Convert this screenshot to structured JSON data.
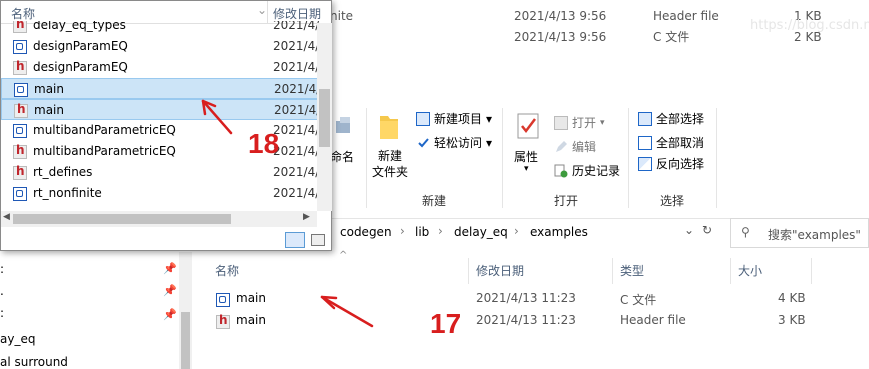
{
  "background_rows": [
    {
      "name": "nite",
      "date": "2021/4/13 9:56",
      "type": "Header file",
      "size": "1 KB"
    },
    {
      "name": "",
      "date": "2021/4/13 9:56",
      "type": "C 文件",
      "size": "2 KB"
    }
  ],
  "watermark": "https://blog.csdn.n",
  "ribbon": {
    "partial_label": "命名",
    "new_folder": "新建\n文件夹",
    "new_item": "新建项目",
    "easy_access": "轻松访问",
    "group_new": "新建",
    "properties": "属性",
    "open": "打开",
    "edit": "编辑",
    "history": "历史记录",
    "group_open": "打开",
    "select_all": "全部选择",
    "select_none": "全部取消",
    "invert": "反向选择",
    "group_select": "选择"
  },
  "address": {
    "crumbs": [
      "codegen",
      "lib",
      "delay_eq",
      "examples"
    ]
  },
  "search": {
    "placeholder": "搜索\"examples\""
  },
  "nav": {
    "items": [
      "ay_eq",
      "al surround"
    ]
  },
  "columns": {
    "name": "名称",
    "date": "修改日期",
    "type": "类型",
    "size": "大小"
  },
  "files": [
    {
      "name": "main",
      "date": "2021/4/13 11:23",
      "type": "C 文件",
      "size": "4 KB",
      "icon": "c-file-icon"
    },
    {
      "name": "main",
      "date": "2021/4/13 11:23",
      "type": "Header file",
      "size": "3 KB",
      "icon": "h-file-icon"
    }
  ],
  "popup": {
    "col_name": "名称",
    "col_date": "修改日期",
    "rows": [
      {
        "name": "delay_eq_types",
        "date": "2021/4/",
        "icon": "h"
      },
      {
        "name": "designParamEQ",
        "date": "2021/4/",
        "icon": "c"
      },
      {
        "name": "designParamEQ",
        "date": "2021/4/",
        "icon": "h"
      },
      {
        "name": "main",
        "date": "2021/4/",
        "icon": "c"
      },
      {
        "name": "main",
        "date": "2021/4/",
        "icon": "h"
      },
      {
        "name": "multibandParametricEQ",
        "date": "2021/4/",
        "icon": "c"
      },
      {
        "name": "multibandParametricEQ",
        "date": "2021/4/",
        "icon": "h"
      },
      {
        "name": "rt_defines",
        "date": "2021/4/",
        "icon": "h"
      },
      {
        "name": "rt_nonfinite",
        "date": "2021/4/",
        "icon": "c"
      }
    ]
  },
  "annotations": {
    "label_18": "18",
    "label_17": "17",
    "color": "#d81e1e"
  }
}
